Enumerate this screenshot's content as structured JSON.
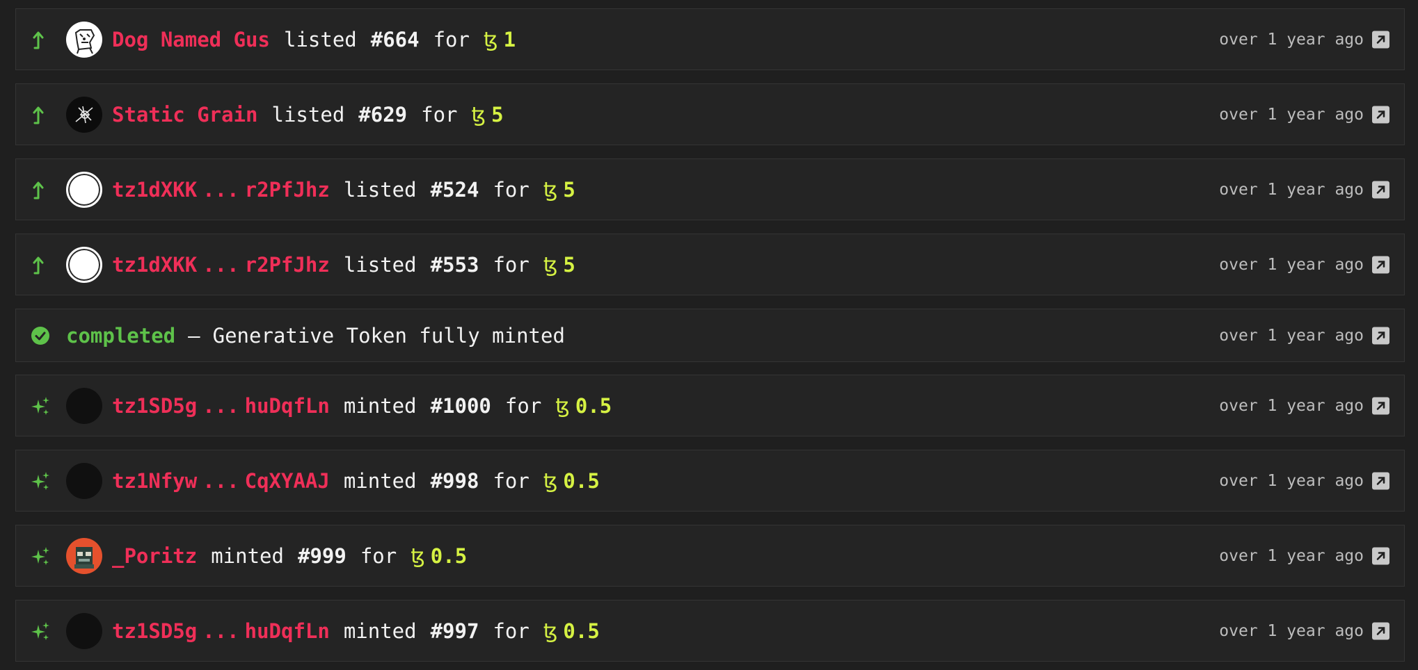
{
  "activity": [
    {
      "kind": "listed",
      "icon": "listed-arrow-icon",
      "avatar": "dog",
      "user": "Dog Named Gus",
      "user_end": "",
      "verb": "listed",
      "token": "#664",
      "for_label": "for",
      "currency_symbol": "ꜩ",
      "price": "1",
      "time": "over 1 year ago"
    },
    {
      "kind": "listed",
      "icon": "listed-arrow-icon",
      "avatar": "grain",
      "user": "Static Grain",
      "user_end": "",
      "verb": "listed",
      "token": "#629",
      "for_label": "for",
      "currency_symbol": "ꜩ",
      "price": "5",
      "time": "over 1 year ago"
    },
    {
      "kind": "listed",
      "icon": "listed-arrow-icon",
      "avatar": "blank",
      "user": "tz1dXKK",
      "user_end": "r2PfJhz",
      "verb": "listed",
      "token": "#524",
      "for_label": "for",
      "currency_symbol": "ꜩ",
      "price": "5",
      "time": "over 1 year ago"
    },
    {
      "kind": "listed",
      "icon": "listed-arrow-icon",
      "avatar": "blank",
      "user": "tz1dXKK",
      "user_end": "r2PfJhz",
      "verb": "listed",
      "token": "#553",
      "for_label": "for",
      "currency_symbol": "ꜩ",
      "price": "5",
      "time": "over 1 year ago"
    },
    {
      "kind": "status",
      "icon": "check-circle-icon",
      "status": "completed",
      "dash": "—",
      "message": "Generative Token fully minted",
      "time": "over 1 year ago"
    },
    {
      "kind": "minted",
      "icon": "sparkles-icon",
      "avatar": "dark",
      "user": "tz1SD5g",
      "user_end": "huDqfLn",
      "verb": "minted",
      "token": "#1000",
      "for_label": "for",
      "currency_symbol": "ꜩ",
      "price": "0.5",
      "time": "over 1 year ago"
    },
    {
      "kind": "minted",
      "icon": "sparkles-icon",
      "avatar": "dark",
      "user": "tz1Nfyw",
      "user_end": "CqXYAAJ",
      "verb": "minted",
      "token": "#998",
      "for_label": "for",
      "currency_symbol": "ꜩ",
      "price": "0.5",
      "time": "over 1 year ago"
    },
    {
      "kind": "minted",
      "icon": "sparkles-icon",
      "avatar": "poritz",
      "user": "_Poritz",
      "user_end": "",
      "verb": "minted",
      "token": "#999",
      "for_label": "for",
      "currency_symbol": "ꜩ",
      "price": "0.5",
      "time": "over 1 year ago"
    },
    {
      "kind": "minted",
      "icon": "sparkles-icon",
      "avatar": "dark",
      "user": "tz1SD5g",
      "user_end": "huDqfLn",
      "verb": "minted",
      "token": "#997",
      "for_label": "for",
      "currency_symbol": "ꜩ",
      "price": "0.5",
      "time": "over 1 year ago"
    }
  ],
  "ellipsis": "...",
  "colors": {
    "background": "#1f1f1f",
    "row_background": "#242424",
    "row_border": "#343434",
    "user": "#ef2f58",
    "price": "#d6f243",
    "accent_green": "#5ec24a",
    "time": "#bdbdbd"
  }
}
